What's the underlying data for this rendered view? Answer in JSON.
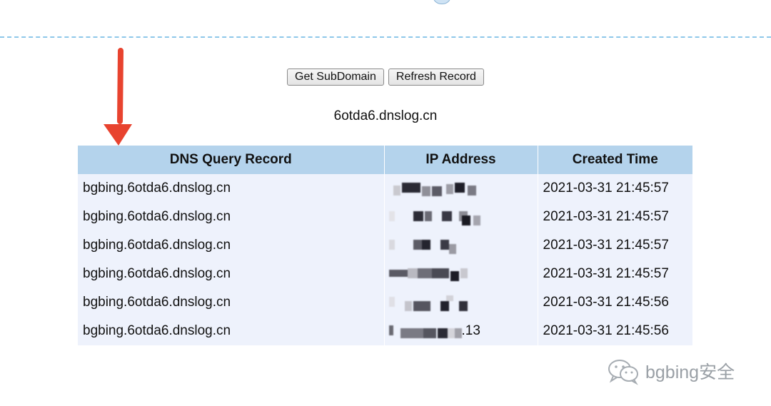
{
  "buttons": {
    "get_subdomain": "Get SubDomain",
    "refresh_record": "Refresh Record"
  },
  "subdomain": "6otda6.dnslog.cn",
  "table": {
    "headers": [
      "DNS Query Record",
      "IP Address",
      "Created Time"
    ],
    "rows": [
      {
        "query": "bgbing.6otda6.dnslog.cn",
        "ip": "",
        "time": "2021-03-31 21:45:57"
      },
      {
        "query": "bgbing.6otda6.dnslog.cn",
        "ip": "",
        "time": "2021-03-31 21:45:57"
      },
      {
        "query": "bgbing.6otda6.dnslog.cn",
        "ip": "",
        "time": "2021-03-31 21:45:57"
      },
      {
        "query": "bgbing.6otda6.dnslog.cn",
        "ip": "",
        "time": "2021-03-31 21:45:57"
      },
      {
        "query": "bgbing.6otda6.dnslog.cn",
        "ip": "",
        "time": "2021-03-31 21:45:56"
      },
      {
        "query": "bgbing.6otda6.dnslog.cn",
        "ip": ".13",
        "time": "2021-03-31 21:45:56"
      }
    ]
  },
  "watermark": "bgbing安全",
  "colors": {
    "header_bg": "#b4d3ec",
    "row_bg": "#eef2fc",
    "arrow": "#e8432f",
    "dashed_line": "#8ec7ea"
  }
}
